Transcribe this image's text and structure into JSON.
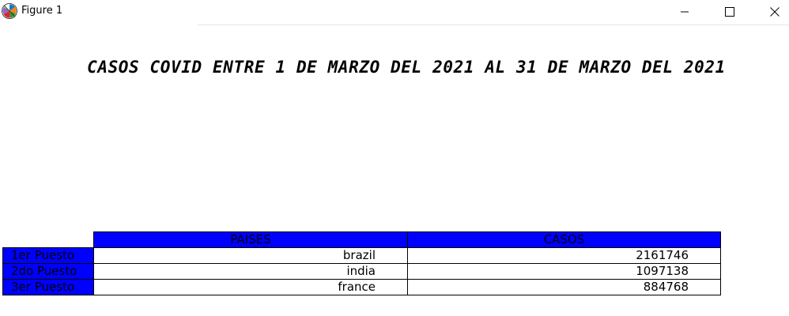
{
  "window": {
    "title": "Figure 1",
    "app_icon": "matplotlib-icon",
    "controls": {
      "minimize": "minimize-icon",
      "maximize": "maximize-icon",
      "close": "close-icon"
    }
  },
  "figure": {
    "title": "CASOS COVID ENTRE 1 DE MARZO DEL 2021 AL 31 DE MARZO DEL 2021",
    "header_color": "#0000ff"
  },
  "chart_data": {
    "type": "table",
    "title": "CASOS COVID ENTRE 1 DE MARZO DEL 2021 AL 31 DE MARZO DEL 2021",
    "columns": [
      "PAISES",
      "CASOS"
    ],
    "row_labels": [
      "1er Puesto",
      "2do Puesto",
      "3er Puesto"
    ],
    "rows": [
      [
        "brazil",
        "2161746"
      ],
      [
        "india",
        "1097138"
      ],
      [
        "france",
        "884768"
      ]
    ]
  }
}
